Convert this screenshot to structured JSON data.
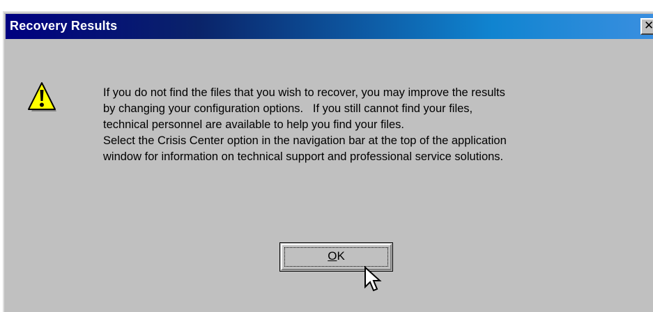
{
  "dialog": {
    "title": "Recovery Results",
    "close_glyph": "✕",
    "icon": "warning-icon",
    "message_lines": [
      "If you do not find the files that you wish to recover, you may improve the results",
      "by changing your configuration options.   If you still cannot find your files,",
      "technical personnel are available to help you find your files.",
      "Select the Crisis Center option in the navigation bar at the top of the application",
      "window for information on technical support and professional service solutions."
    ],
    "ok_button": {
      "accel": "O",
      "rest": "K"
    }
  },
  "colors": {
    "dialog_face": "#c0c0c0",
    "titlebar_start": "#000080",
    "titlebar_end": "#3a8fe0",
    "warning_yellow": "#ffff00"
  }
}
